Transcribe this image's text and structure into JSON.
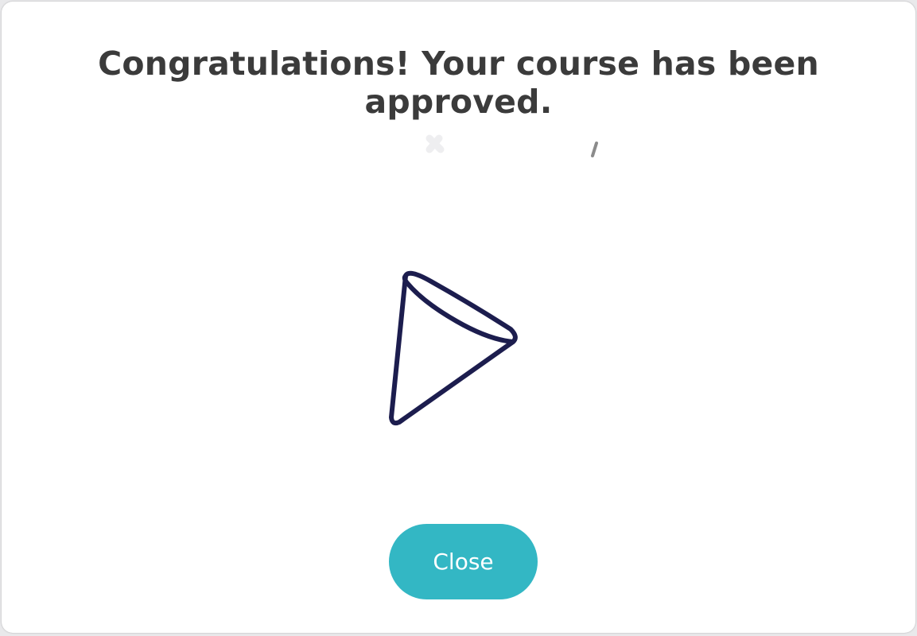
{
  "dialog": {
    "title": "Congratulations! Your course has been approved.",
    "close_label": "Close"
  },
  "icons": {
    "illustration": "party-hat-icon",
    "confetti": "confetti-icon"
  },
  "colors": {
    "accent": "#33b7c4",
    "title_text": "#3b3b3b",
    "icon_stroke": "#1c1d4e"
  }
}
